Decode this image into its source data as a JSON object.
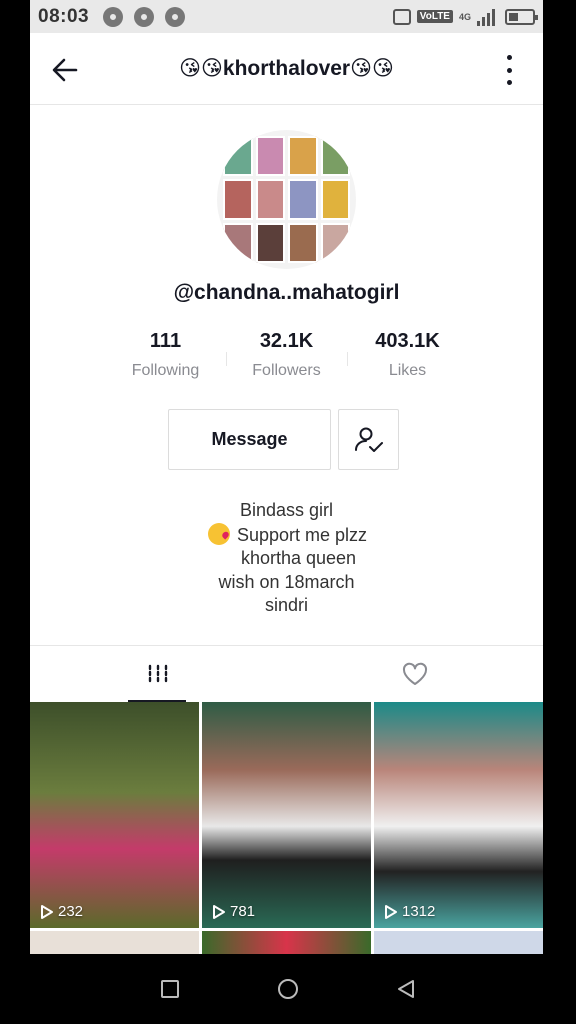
{
  "status_bar": {
    "time": "08:03",
    "volte_label": "VoLTE",
    "network_label": "4G"
  },
  "header": {
    "title": "😘😘khorthalover😘😘"
  },
  "profile": {
    "username": "@chandna..mahatogirl",
    "stats": [
      {
        "value": "111",
        "label": "Following"
      },
      {
        "value": "32.1K",
        "label": "Followers"
      },
      {
        "value": "403.1K",
        "label": "Likes"
      }
    ],
    "message_label": "Message",
    "bio": {
      "line1": "Bindass girl",
      "line2": "Support me plzz",
      "line3": "khortha queen",
      "line4": "wish on 18march",
      "line5": "sindri"
    }
  },
  "tabs": {
    "videos_icon": "grid-icon",
    "liked_icon": "heart-icon"
  },
  "videos": [
    {
      "views": "232"
    },
    {
      "views": "781"
    },
    {
      "views": "1312"
    }
  ],
  "colors": {
    "text": "#161823",
    "secondary_text": "#8a8b91",
    "border": "#e6e6e6"
  }
}
